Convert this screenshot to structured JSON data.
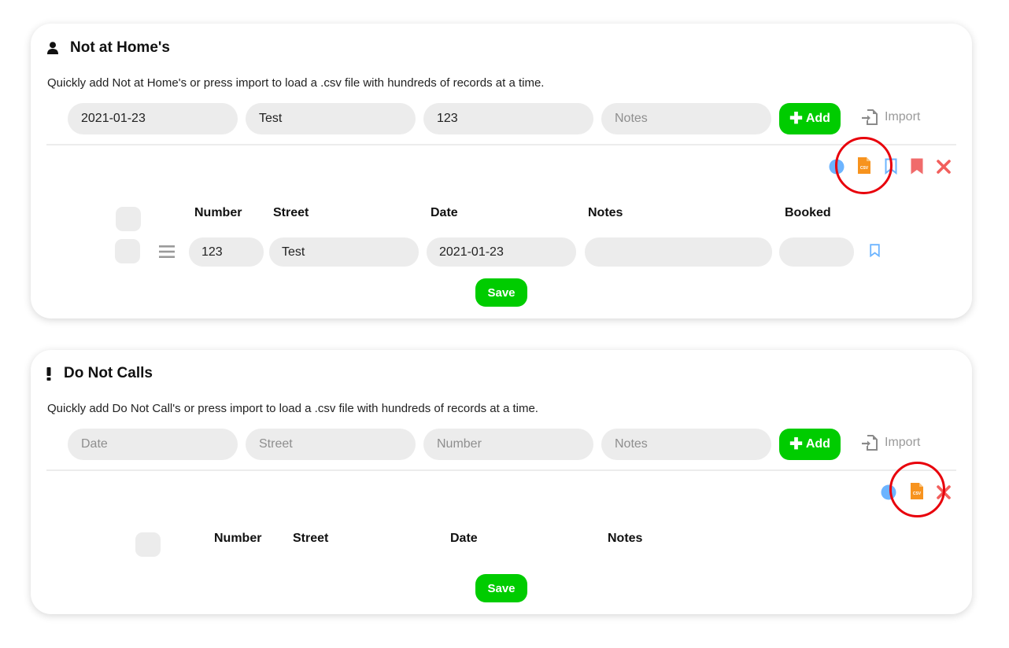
{
  "not_at_homes": {
    "title": "Not at Home's",
    "description": "Quickly add Not at Home's or press import to load a .csv file with hundreds of records at a time.",
    "form": {
      "field1": {
        "value": "2021-01-23"
      },
      "field2": {
        "value": "Test"
      },
      "field3": {
        "value": "123"
      },
      "notes": {
        "value": "",
        "placeholder": "Notes"
      }
    },
    "add_label": "Add",
    "import_label": "Import",
    "toolbar_icons": [
      "info-icon",
      "csv-file-icon",
      "bookmark-outline-icon",
      "bookmark-filled-icon",
      "close-icon"
    ],
    "table": {
      "headers": {
        "number": "Number",
        "street": "Street",
        "date": "Date",
        "notes": "Notes",
        "booked": "Booked"
      },
      "rows": [
        {
          "number": "123",
          "street": "Test",
          "date": "2021-01-23",
          "notes": "",
          "booked": ""
        }
      ]
    },
    "save_label": "Save"
  },
  "do_not_calls": {
    "title": "Do Not Calls",
    "description": "Quickly add Do Not Call's or press import to load a .csv file with hundreds of records at a time.",
    "form": {
      "date": {
        "placeholder": "Date"
      },
      "street": {
        "placeholder": "Street"
      },
      "number": {
        "placeholder": "Number"
      },
      "notes": {
        "placeholder": "Notes"
      }
    },
    "add_label": "Add",
    "import_label": "Import",
    "toolbar_icons": [
      "info-icon",
      "csv-file-icon",
      "close-icon"
    ],
    "table": {
      "headers": {
        "number": "Number",
        "street": "Street",
        "date": "Date",
        "notes": "Notes"
      },
      "rows": []
    },
    "save_label": "Save"
  },
  "colors": {
    "accent_green": "#00cc00",
    "field_gray": "#ececec",
    "info_blue": "#6cb4ff",
    "csv_orange": "#f7931e",
    "bookmark_red": "#f06b6b",
    "close_red": "#f25f5c",
    "highlight_ring_red": "#e8000b"
  }
}
